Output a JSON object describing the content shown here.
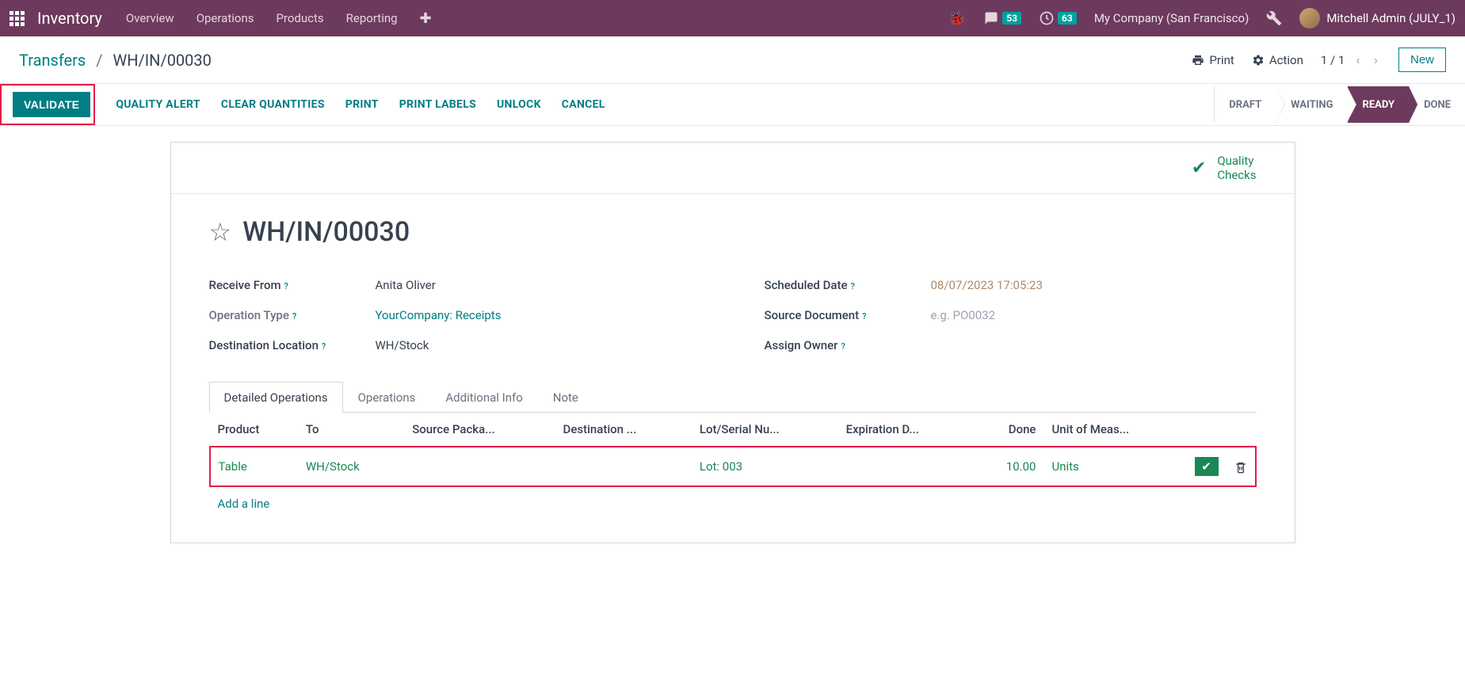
{
  "navbar": {
    "brand": "Inventory",
    "links": [
      "Overview",
      "Operations",
      "Products",
      "Reporting"
    ],
    "messages_count": "53",
    "activities_count": "63",
    "company": "My Company (San Francisco)",
    "user": "Mitchell Admin (JULY_1)"
  },
  "breadcrumb": {
    "root": "Transfers",
    "current": "WH/IN/00030"
  },
  "control_panel": {
    "print": "Print",
    "action": "Action",
    "pager": "1 / 1",
    "new_btn": "New"
  },
  "statusbar": {
    "validate": "VALIDATE",
    "actions": [
      "QUALITY ALERT",
      "CLEAR QUANTITIES",
      "PRINT",
      "PRINT LABELS",
      "UNLOCK",
      "CANCEL"
    ],
    "states": [
      "DRAFT",
      "WAITING",
      "READY",
      "DONE"
    ],
    "active_state": "READY"
  },
  "sheet": {
    "quality_checks": "Quality Checks",
    "title": "WH/IN/00030",
    "fields": {
      "receive_from_label": "Receive From",
      "receive_from_value": "Anita Oliver",
      "operation_type_label": "Operation Type",
      "operation_type_value": "YourCompany: Receipts",
      "destination_location_label": "Destination Location",
      "destination_location_value": "WH/Stock",
      "scheduled_date_label": "Scheduled Date",
      "scheduled_date_value": "08/07/2023 17:05:23",
      "source_document_label": "Source Document",
      "source_document_placeholder": "e.g. PO0032",
      "assign_owner_label": "Assign Owner"
    }
  },
  "tabs": [
    "Detailed Operations",
    "Operations",
    "Additional Info",
    "Note"
  ],
  "table": {
    "headers": {
      "product": "Product",
      "to": "To",
      "source_package": "Source Packa...",
      "destination": "Destination ...",
      "lot_serial": "Lot/Serial Nu...",
      "expiration": "Expiration D...",
      "done": "Done",
      "uom": "Unit of Meas..."
    },
    "row": {
      "product": "Table",
      "to": "WH/Stock",
      "lot": "Lot: 003",
      "done": "10.00",
      "uom": "Units"
    },
    "add_line": "Add a line"
  }
}
